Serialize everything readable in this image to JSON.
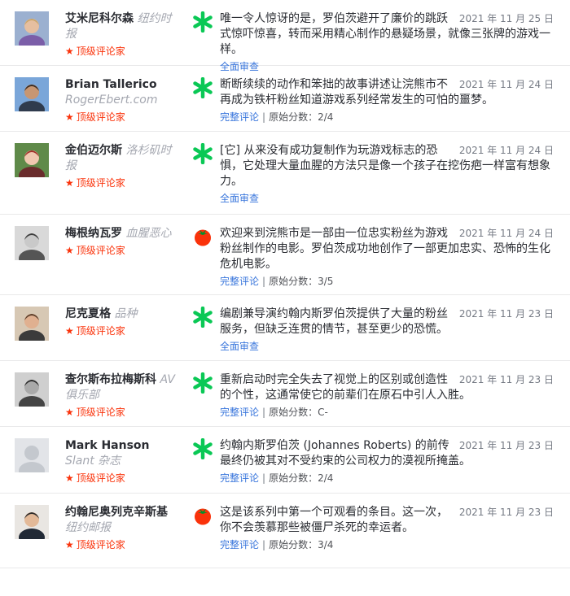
{
  "reviews": [
    {
      "name": "艾米尼科尔森",
      "publication": "纽约时报",
      "top_critic_label": "顶级评论家",
      "score_type": "rotten",
      "date": "2021 年 11 月 25 日",
      "quote": "唯一令人惊讶的是，罗伯茨避开了廉价的跳跃式惊吓惊喜，转而采用精心制作的悬疑场景，就像三张牌的游戏一样。",
      "link_label": "全面审查",
      "score_label": "",
      "score_value": ""
    },
    {
      "name": "Brian Tallerico",
      "publication": "RogerEbert.com",
      "top_critic_label": "顶级评论家",
      "score_type": "rotten",
      "date": "2021 年 11 月 24 日",
      "quote": "断断续续的动作和笨拙的故事讲述让浣熊市不再成为铁杆粉丝知道游戏系列经常发生的可怕的噩梦。",
      "link_label": "完整评论",
      "score_label": "原始分数：",
      "score_value": "2/4"
    },
    {
      "name": "金伯迈尔斯",
      "publication": "洛杉矶时报",
      "top_critic_label": "顶级评论家",
      "score_type": "rotten",
      "date": "2021 年 11 月 24 日",
      "quote": "[它] 从来没有成功复制作为玩游戏标志的恐惧，它处理大量血腥的方法只是像一个孩子在挖伤疤一样富有想象力。",
      "link_label": "全面审查",
      "score_label": "",
      "score_value": ""
    },
    {
      "name": "梅根纳瓦罗",
      "publication": "血腥恶心",
      "top_critic_label": "顶级评论家",
      "score_type": "fresh",
      "date": "2021 年 11 月 24 日",
      "quote": "欢迎来到浣熊市是一部由一位忠实粉丝为游戏粉丝制作的电影。罗伯茨成功地创作了一部更加忠实、恐怖的生化危机电影。",
      "link_label": "完整评论",
      "score_label": "原始分数：",
      "score_value": "3/5"
    },
    {
      "name": "尼克夏格",
      "publication": "品种",
      "top_critic_label": "顶级评论家",
      "score_type": "rotten",
      "date": "2021 年 11 月 23 日",
      "quote": "编剧兼导演约翰内斯罗伯茨提供了大量的粉丝服务，但缺乏连贯的情节，甚至更少的恐慌。",
      "link_label": "全面审查",
      "score_label": "",
      "score_value": ""
    },
    {
      "name": "查尔斯布拉梅斯科",
      "publication": "AV 俱乐部",
      "top_critic_label": "顶级评论家",
      "score_type": "rotten",
      "date": "2021 年 11 月 23 日",
      "quote": "重新启动时完全失去了视觉上的区别或创造性的个性，这通常使它的前辈们在原石中引人入胜。",
      "link_label": "完整评论",
      "score_label": "原始分数：",
      "score_value": "C-"
    },
    {
      "name": "Mark Hanson",
      "publication": "Slant 杂志",
      "top_critic_label": "顶级评论家",
      "score_type": "rotten",
      "date": "2021 年 11 月 23 日",
      "quote": "约翰内斯罗伯茨 (Johannes Roberts) 的前传最终仍被其对不受约束的公司权力的漠视所掩盖。",
      "link_label": "完整评论",
      "score_label": "原始分数：",
      "score_value": "2/4"
    },
    {
      "name": "约翰尼奥列克辛斯基",
      "publication": "纽约邮报",
      "top_critic_label": "顶级评论家",
      "score_type": "fresh",
      "date": "2021 年 11 月 23 日",
      "quote": "这是该系列中第一个可观看的条目。这一次，你不会羡慕那些被僵尸杀死的幸运者。",
      "link_label": "完整评论",
      "score_label": "原始分数：",
      "score_value": "3/4"
    }
  ],
  "colors": {
    "rotten": "#0ac855",
    "fresh": "#fa320a",
    "link": "#3976dc",
    "top_critic": "#fa320a"
  }
}
